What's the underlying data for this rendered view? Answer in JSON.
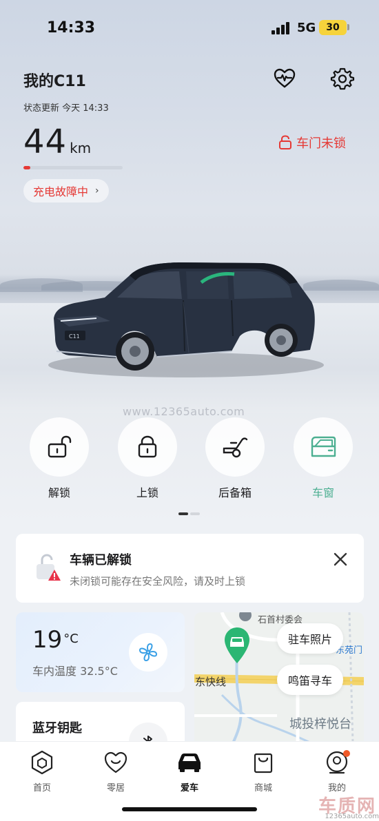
{
  "status_bar": {
    "time": "14:33",
    "network": "5G",
    "battery": "30"
  },
  "header": {
    "car_name": "我的C11",
    "status_update": "状态更新 今天 14:33",
    "health_icon": "heart-pulse-icon",
    "settings_icon": "gear-icon"
  },
  "range": {
    "value": "44",
    "unit": "km",
    "level_fraction": 0.07,
    "bar_color": "#e53935"
  },
  "door_status": {
    "label": "车门未锁",
    "color": "#e53935"
  },
  "charge_fault": {
    "label": "充电故障中",
    "chevron": "›"
  },
  "watermark": "www.12365auto.com",
  "car_image": {
    "badge": "C11"
  },
  "quick_actions": [
    {
      "label": "解锁",
      "icon": "unlock-icon"
    },
    {
      "label": "上锁",
      "icon": "lock-icon"
    },
    {
      "label": "后备箱",
      "icon": "trunk-icon"
    },
    {
      "label": "车窗",
      "icon": "window-icon",
      "color": "#4caf91"
    }
  ],
  "alert": {
    "title": "车辆已解锁",
    "message": "未闭锁可能存在安全风险，请及时上锁"
  },
  "climate": {
    "temperature": "19",
    "unit": "°C",
    "cabin_label": "车内温度 32.5°C"
  },
  "bluetooth": {
    "title": "蓝牙钥匙"
  },
  "map": {
    "road_label": "东快线",
    "place_top": "石首村委会",
    "place_mid": "东苑门",
    "place_bottom": "城投梓悦台",
    "parking_photo": "驻车照片",
    "honk_find": "鸣笛寻车"
  },
  "tabbar": [
    {
      "label": "首页",
      "icon": "hexagon-home-icon"
    },
    {
      "label": "零居",
      "icon": "heart-smile-icon"
    },
    {
      "label": "爱车",
      "icon": "car-icon",
      "active": true
    },
    {
      "label": "商城",
      "icon": "shopping-bag-icon"
    },
    {
      "label": "我的",
      "icon": "profile-icon",
      "badge": true
    }
  ],
  "corner_logo": {
    "big": "车质网",
    "small": "12365auto.com"
  }
}
